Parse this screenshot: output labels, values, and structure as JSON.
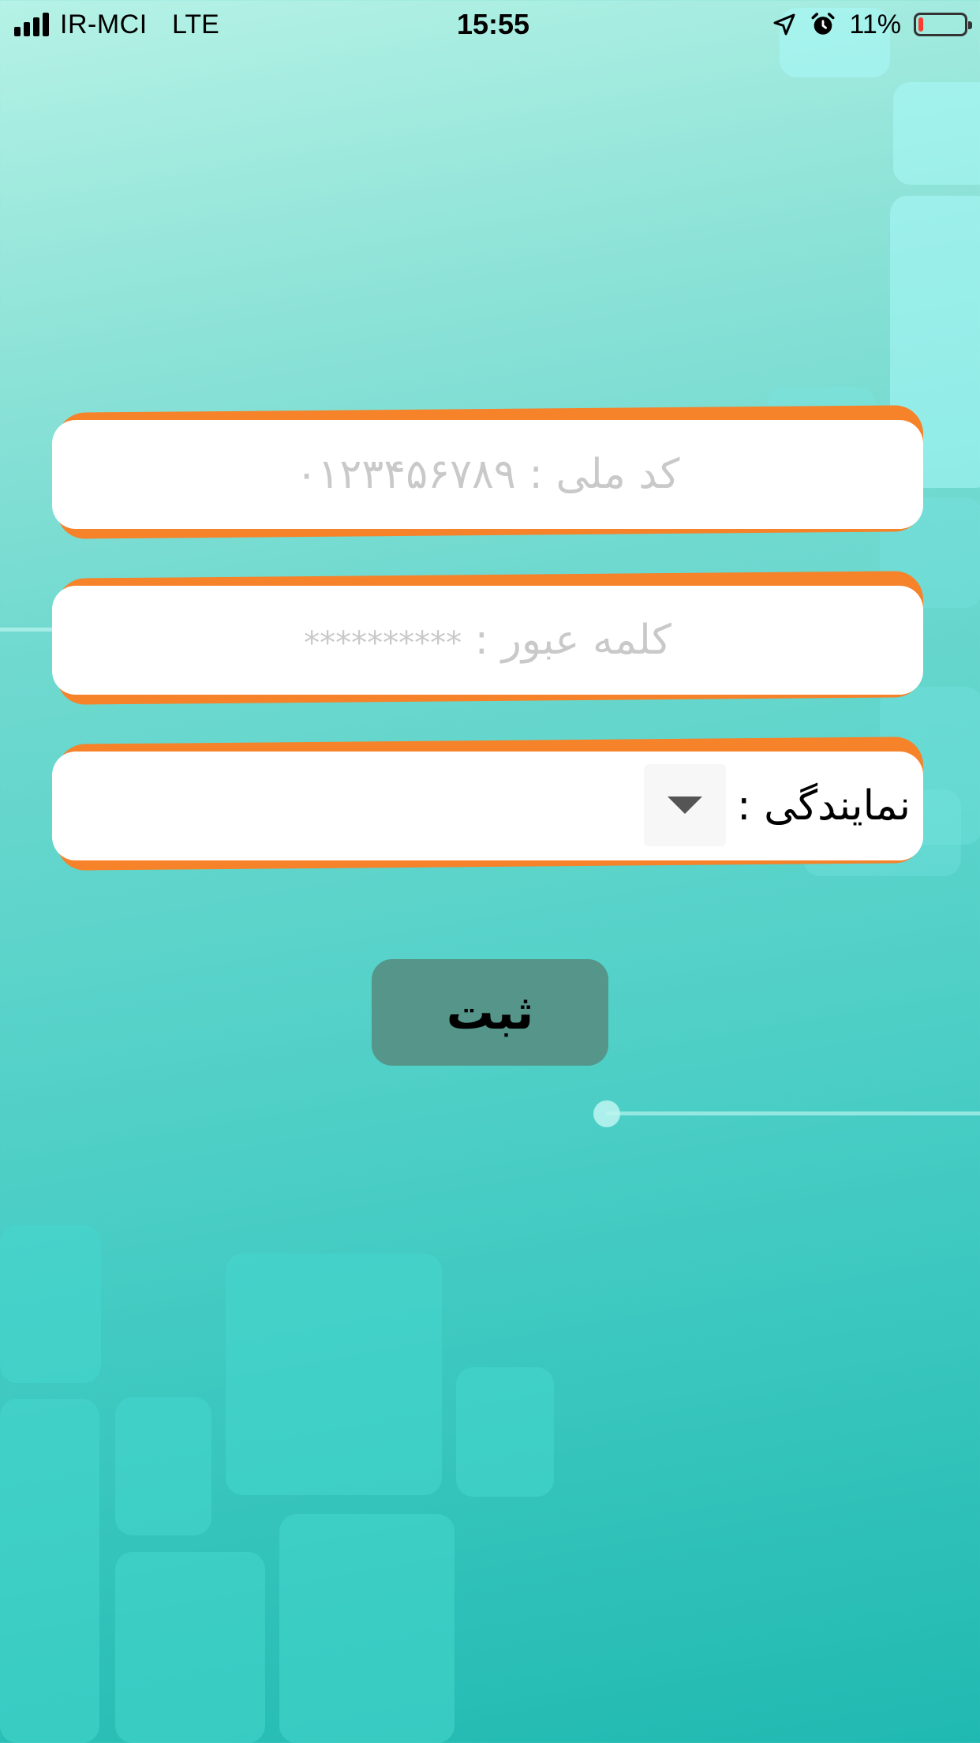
{
  "status_bar": {
    "carrier": "IR-MCI",
    "network": "LTE",
    "time": "15:55",
    "battery_percent": "11%",
    "battery_level": 0.11,
    "icons": [
      "signal-icon",
      "location-arrow-icon",
      "alarm-clock-icon",
      "battery-icon"
    ]
  },
  "form": {
    "national_code": {
      "label": "کد ملی :",
      "placeholder": "۰۱۲۳۴۵۶۷۸۹"
    },
    "password": {
      "label": "کلمه عبور :",
      "placeholder": "**********"
    },
    "agency": {
      "label": "نمایندگی :",
      "dropdown_icon": "chevron-down-icon"
    },
    "submit_label": "ثبت"
  },
  "colors": {
    "field_accent": "#f6822a",
    "field_background": "#ffffff",
    "placeholder_text": "#c9c9c9",
    "submit_background": "#55958a",
    "battery_low": "#ff3b30"
  }
}
